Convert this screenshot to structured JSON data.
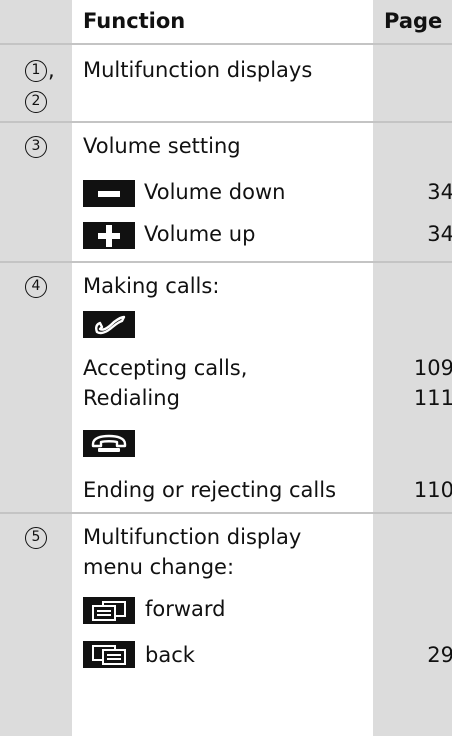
{
  "header": {
    "function_label": "Function",
    "page_label": "Page"
  },
  "rows": [
    {
      "numbers": [
        "1",
        "2"
      ],
      "separator": ",",
      "title": "Multifunction displays"
    },
    {
      "numbers": [
        "3"
      ],
      "title": "Volume setting",
      "items": [
        {
          "icon": "minus-button-icon",
          "label": "Volume down",
          "page": "34"
        },
        {
          "icon": "plus-button-icon",
          "label": "Volume up",
          "page": "34"
        }
      ]
    },
    {
      "numbers": [
        "4"
      ],
      "title": "Making calls:",
      "items": [
        {
          "icon": "phone-accept-icon"
        },
        {
          "label_lines": [
            "Accepting calls,",
            "Redialing"
          ],
          "pages": [
            "109",
            "111"
          ]
        },
        {
          "icon": "phone-end-icon"
        },
        {
          "label": "Ending or rejecting calls",
          "page": "110"
        }
      ]
    },
    {
      "numbers": [
        "5"
      ],
      "title_lines": [
        "Multifunction display",
        "menu change:"
      ],
      "items": [
        {
          "icon": "menu-forward-icon",
          "label": "forward"
        },
        {
          "icon": "menu-back-icon",
          "label": "back",
          "page": "29"
        }
      ]
    }
  ],
  "colors": {
    "column_shade": "#dcdcdc",
    "rule": "#c4c4c4",
    "text": "#111111",
    "icon_background": "#111111"
  }
}
